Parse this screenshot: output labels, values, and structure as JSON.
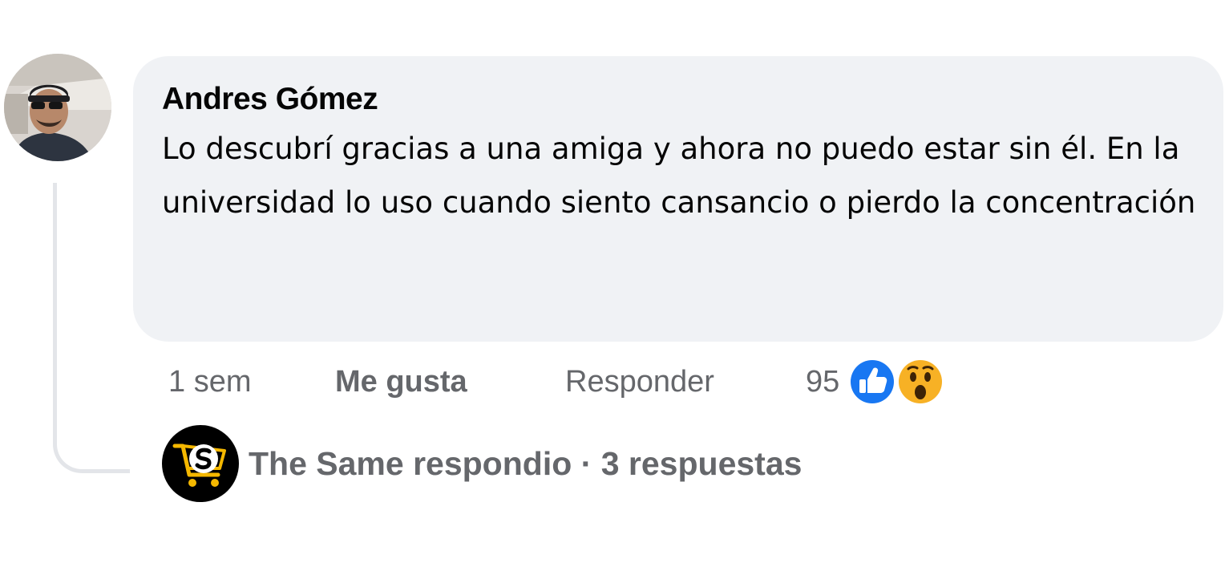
{
  "comment": {
    "author": "Andres Gómez",
    "text": "Lo descubrí gracias a una amiga y ahora no puedo estar sin él. En la universidad lo uso cuando siento cansancio o pierdo la concentración",
    "time": "1 sem",
    "like_label": "Me gusta",
    "reply_label": "Responder",
    "reaction_count": "95",
    "reaction_icons": [
      "like-reaction-icon",
      "wow-reaction-icon"
    ]
  },
  "replies": {
    "replier": "The Same respondio",
    "separator": "·",
    "count_label": "3 respuestas"
  },
  "colors": {
    "bubble": "#f0f2f5",
    "text": "#050505",
    "muted": "#65676b",
    "like_blue": "#1877f2",
    "wow_yellow": "#f7b125",
    "brand_yellow": "#f5b800"
  }
}
